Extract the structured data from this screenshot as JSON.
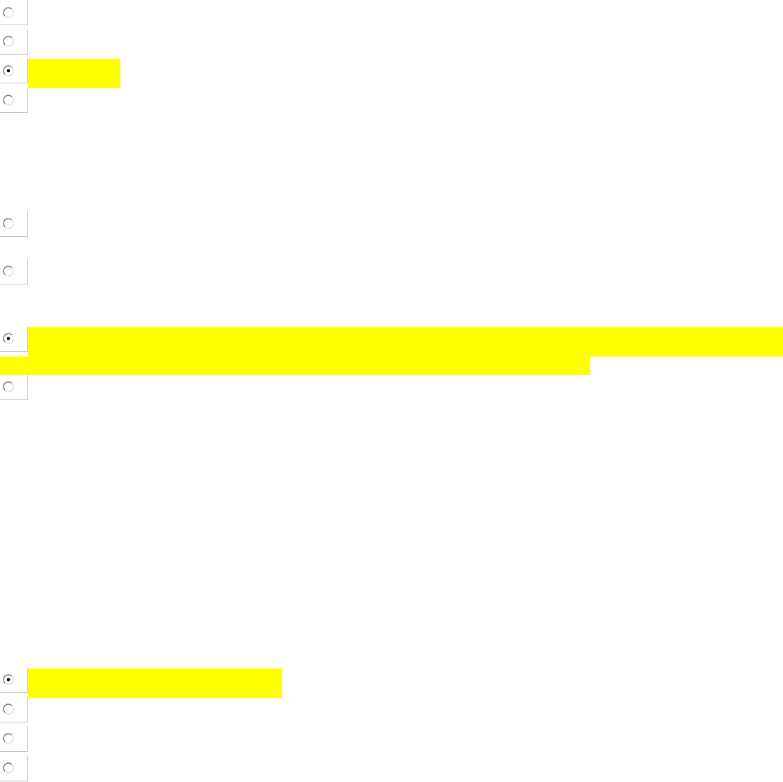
{
  "questions": [
    {
      "options": [
        {
          "selected": false,
          "highlighted": false
        },
        {
          "selected": false,
          "highlighted": false
        },
        {
          "selected": true,
          "highlighted": true
        },
        {
          "selected": false,
          "highlighted": false
        }
      ]
    },
    {
      "options": [
        {
          "selected": false,
          "highlighted": false
        },
        {
          "selected": false,
          "highlighted": false
        },
        {
          "selected": true,
          "highlighted": true
        },
        {
          "selected": false,
          "highlighted": false
        }
      ]
    },
    {
      "options": [
        {
          "selected": true,
          "highlighted": true
        },
        {
          "selected": false,
          "highlighted": false
        },
        {
          "selected": false,
          "highlighted": false
        },
        {
          "selected": false,
          "highlighted": false
        }
      ]
    }
  ]
}
